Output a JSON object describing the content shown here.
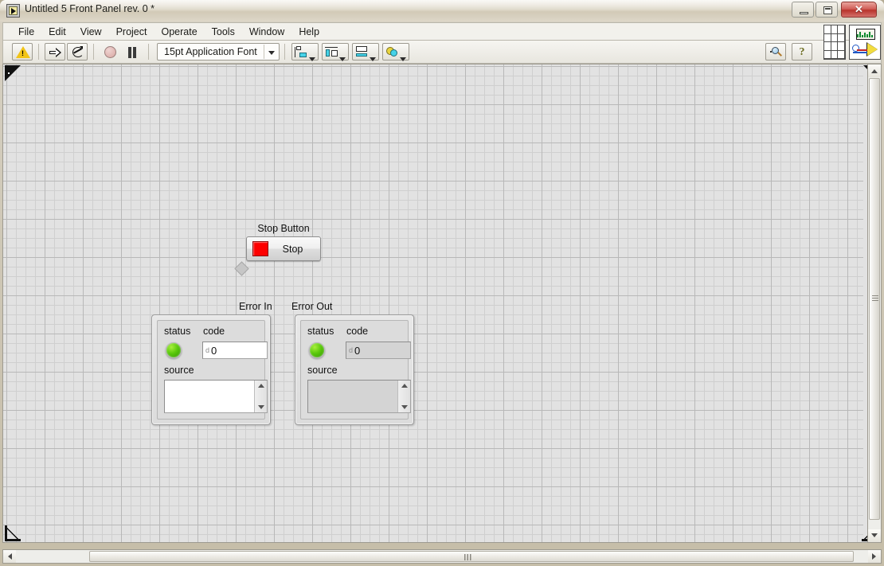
{
  "window": {
    "title": "Untitled 5 Front Panel rev. 0 *",
    "app_icon": "labview-vi-icon",
    "controls": {
      "minimize": "Minimize",
      "maximize": "Maximize",
      "close": "Close",
      "close_glyph": "✕"
    }
  },
  "menubar": {
    "items": [
      {
        "label": "File",
        "name": "menu-file"
      },
      {
        "label": "Edit",
        "name": "menu-edit"
      },
      {
        "label": "View",
        "name": "menu-view"
      },
      {
        "label": "Project",
        "name": "menu-project"
      },
      {
        "label": "Operate",
        "name": "menu-operate"
      },
      {
        "label": "Tools",
        "name": "menu-tools"
      },
      {
        "label": "Window",
        "name": "menu-window"
      },
      {
        "label": "Help",
        "name": "menu-help"
      }
    ]
  },
  "toolbar": {
    "broken_run_tooltip": "List Errors",
    "run_tooltip": "Run",
    "run_continuous_tooltip": "Run Continuously",
    "abort_tooltip": "Abort Execution",
    "pause_tooltip": "Pause",
    "font_selector": {
      "value": "15pt Application Font",
      "dropdown_glyph": "▼"
    },
    "align_tooltip": "Align Objects",
    "distribute_tooltip": "Distribute Objects",
    "resize_tooltip": "Resize Objects",
    "reorder_tooltip": "Reorder",
    "search_tooltip": "Search",
    "help_tooltip": "Show Context Help",
    "help_glyph": "?",
    "connector_pane_tooltip": "Connector Pane",
    "vi_icon_tooltip": "VI Icon"
  },
  "panel": {
    "stop_button": {
      "label": "Stop Button",
      "text": "Stop",
      "led_color": "#fd0000",
      "state": "off"
    },
    "error_in": {
      "label": "Error In",
      "kind": "control",
      "status_label": "status",
      "status_value": "no error",
      "status_color": "#5bc90c",
      "code_label": "code",
      "code_radix": "d",
      "code_value": "0",
      "source_label": "source",
      "source_value": ""
    },
    "error_out": {
      "label": "Error Out",
      "kind": "indicator",
      "status_label": "status",
      "status_value": "no error",
      "status_color": "#5bc90c",
      "code_label": "code",
      "code_radix": "d",
      "code_value": "0",
      "source_label": "source",
      "source_value": ""
    }
  },
  "scrollbars": {
    "vertical_name": "vertical-scrollbar",
    "horizontal_name": "horizontal-scrollbar"
  }
}
